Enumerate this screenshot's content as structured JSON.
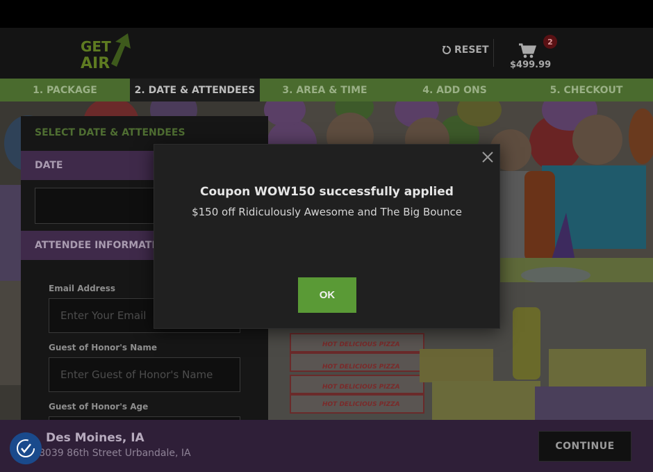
{
  "header": {
    "logo_text_line1": "GET",
    "logo_text_line2": "AIR",
    "reset_label": "RESET",
    "cart_count": "2",
    "cart_total": "$499.99"
  },
  "steps": [
    {
      "label": "1. PACKAGE"
    },
    {
      "label": "2. DATE & ATTENDEES"
    },
    {
      "label": "3. AREA & TIME"
    },
    {
      "label": "4. ADD ONS"
    },
    {
      "label": "5. CHECKOUT"
    }
  ],
  "panel": {
    "title": "SELECT DATE & ATTENDEES",
    "date_heading": "DATE",
    "attendee_heading": "ATTENDEE INFORMATION",
    "email_label": "Email Address",
    "email_placeholder": "Enter Your Email",
    "honor_name_label": "Guest of Honor's Name",
    "honor_name_placeholder": "Enter Guest of Honor's Name",
    "honor_age_label": "Guest of Honor's Age"
  },
  "hero": {
    "pizza_box_label": "HOT DELICIOUS PIZZA"
  },
  "footer": {
    "location_name": "Des Moines, IA",
    "location_address": "8039 86th Street Urbandale, IA",
    "continue_label": "CONTINUE"
  },
  "modal": {
    "title": "Coupon WOW150 successfully applied",
    "message": "$150 off Ridiculously Awesome and The Big Bounce",
    "ok_label": "OK"
  },
  "colors": {
    "accent_green": "#5a9a36",
    "steps_bar": "#4a6b2e",
    "purple_section": "#3f2a4a",
    "footer_purple": "#2f1f38",
    "cart_badge": "#5a1114"
  }
}
